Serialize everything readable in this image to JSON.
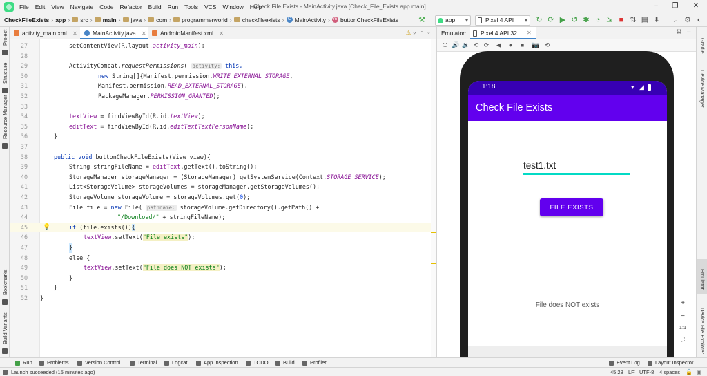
{
  "window": {
    "menu": [
      "File",
      "Edit",
      "View",
      "Navigate",
      "Code",
      "Refactor",
      "Build",
      "Run",
      "Tools",
      "VCS",
      "Window",
      "Help"
    ],
    "title": "Check File Exists - MainActivity.java [Check_File_Exists.app.main]"
  },
  "breadcrumb": [
    "CheckFileExists",
    "app",
    "src",
    "main",
    "java",
    "com",
    "programmerworld",
    "checkfileexists",
    "MainActivity",
    "buttonCheckFileExists"
  ],
  "toolbar": {
    "run_config": "app",
    "device": "Pixel 4 API 32"
  },
  "left_tools": [
    "Project",
    "Structure",
    "Resource Manager",
    "Bookmarks",
    "Build Variants"
  ],
  "right_tools": [
    "Gradle",
    "Device Manager",
    "Emulator",
    "Device File Explorer"
  ],
  "editor_tabs": [
    "activity_main.xml",
    "MainActivity.java",
    "AndroidManifest.xml"
  ],
  "editor": {
    "warning_count": "2",
    "lines": [
      "27",
      "28",
      "29",
      "30",
      "31",
      "32",
      "33",
      "34",
      "35",
      "36",
      "37",
      "38",
      "39",
      "40",
      "41",
      "42",
      "43",
      "44",
      "45",
      "46",
      "47",
      "48",
      "49",
      "50",
      "51",
      "52"
    ],
    "snippets": {
      "l27": "setContentView(R.layout.",
      "l27b": "activity_main",
      "l27c": ");",
      "l29": "ActivityCompat.",
      "l29b": "requestPermissions",
      "l29c": "( ",
      "l29hint": "activity:",
      "l29d": " this,",
      "l30a": "new",
      "l30b": " String[]{Manifest.permission.",
      "l30c": "WRITE_EXTERNAL_STORAGE",
      "l30d": ",",
      "l31a": "Manifest.permission.",
      "l31b": "READ_EXTERNAL_STORAGE",
      "l31c": "},",
      "l32a": "PackageManager.",
      "l32b": "PERMISSION_GRANTED",
      "l32c": ");",
      "l34a": "textView",
      "l34b": " = findViewById(R.id.",
      "l34c": "textView",
      "l34d": ");",
      "l35a": "editText",
      "l35b": " = findViewById(R.id.",
      "l35c": "editTextTextPersonName",
      "l35d": ");",
      "l36": "}",
      "l38a": "public void",
      "l38b": " buttonCheckFileExists(View view){",
      "l39a": "String stringFileName = ",
      "l39b": "editText",
      "l39c": ".getText().toString();",
      "l40a": "StorageManager storageManager = (StorageManager) getSystemService(Context.",
      "l40b": "STORAGE_SERVICE",
      "l40c": ");",
      "l41": "List<StorageVolume> storageVolumes = storageManager.getStorageVolumes();",
      "l42a": "StorageVolume storageVolume = storageVolumes.get(",
      "l42b": "0",
      "l42c": ");",
      "l43a": "File file = ",
      "l43b": "new",
      "l43c": " File( ",
      "l43hint": "pathname:",
      "l43d": " storageVolume.getDirectory().getPath() +",
      "l44a": "\"/Download/\"",
      "l44b": " + stringFileName);",
      "l45a": "if",
      "l45b": " (file.exists())",
      "l45c": "{",
      "l46a": "textView",
      "l46b": ".setText(",
      "l46c": "\"File exists\"",
      "l46d": ");",
      "l47": "}",
      "l48": "else {",
      "l49a": "textView",
      "l49b": ".setText(",
      "l49c": "\"File does NOT exists\"",
      "l49d": ");",
      "l50": "}",
      "l51": "}",
      "l52": "}"
    }
  },
  "emulator": {
    "label": "Emulator:",
    "tab": "Pixel 4 API 32",
    "status_time": "1:18",
    "app_title": "Check File Exists",
    "input_value": "test1.txt",
    "button_label": "FILE EXISTS",
    "result_text": "File does NOT exists",
    "zoom": {
      "in": "+",
      "out": "−",
      "ratio": "1:1"
    }
  },
  "bottom_tools": [
    "Run",
    "Problems",
    "Version Control",
    "Terminal",
    "Logcat",
    "App Inspection",
    "TODO",
    "Build",
    "Profiler",
    "Event Log",
    "Layout Inspector"
  ],
  "status_bar": {
    "message": "Launch succeeded (15 minutes ago)",
    "position": "45:28",
    "line_sep": "LF",
    "encoding": "UTF-8",
    "indent": "4 spaces"
  },
  "colors": {
    "accent": "#6200ee",
    "status": "#3700b3",
    "underline": "#03dac5",
    "keyword": "#0033b3",
    "field": "#871094",
    "string": "#067d17"
  }
}
